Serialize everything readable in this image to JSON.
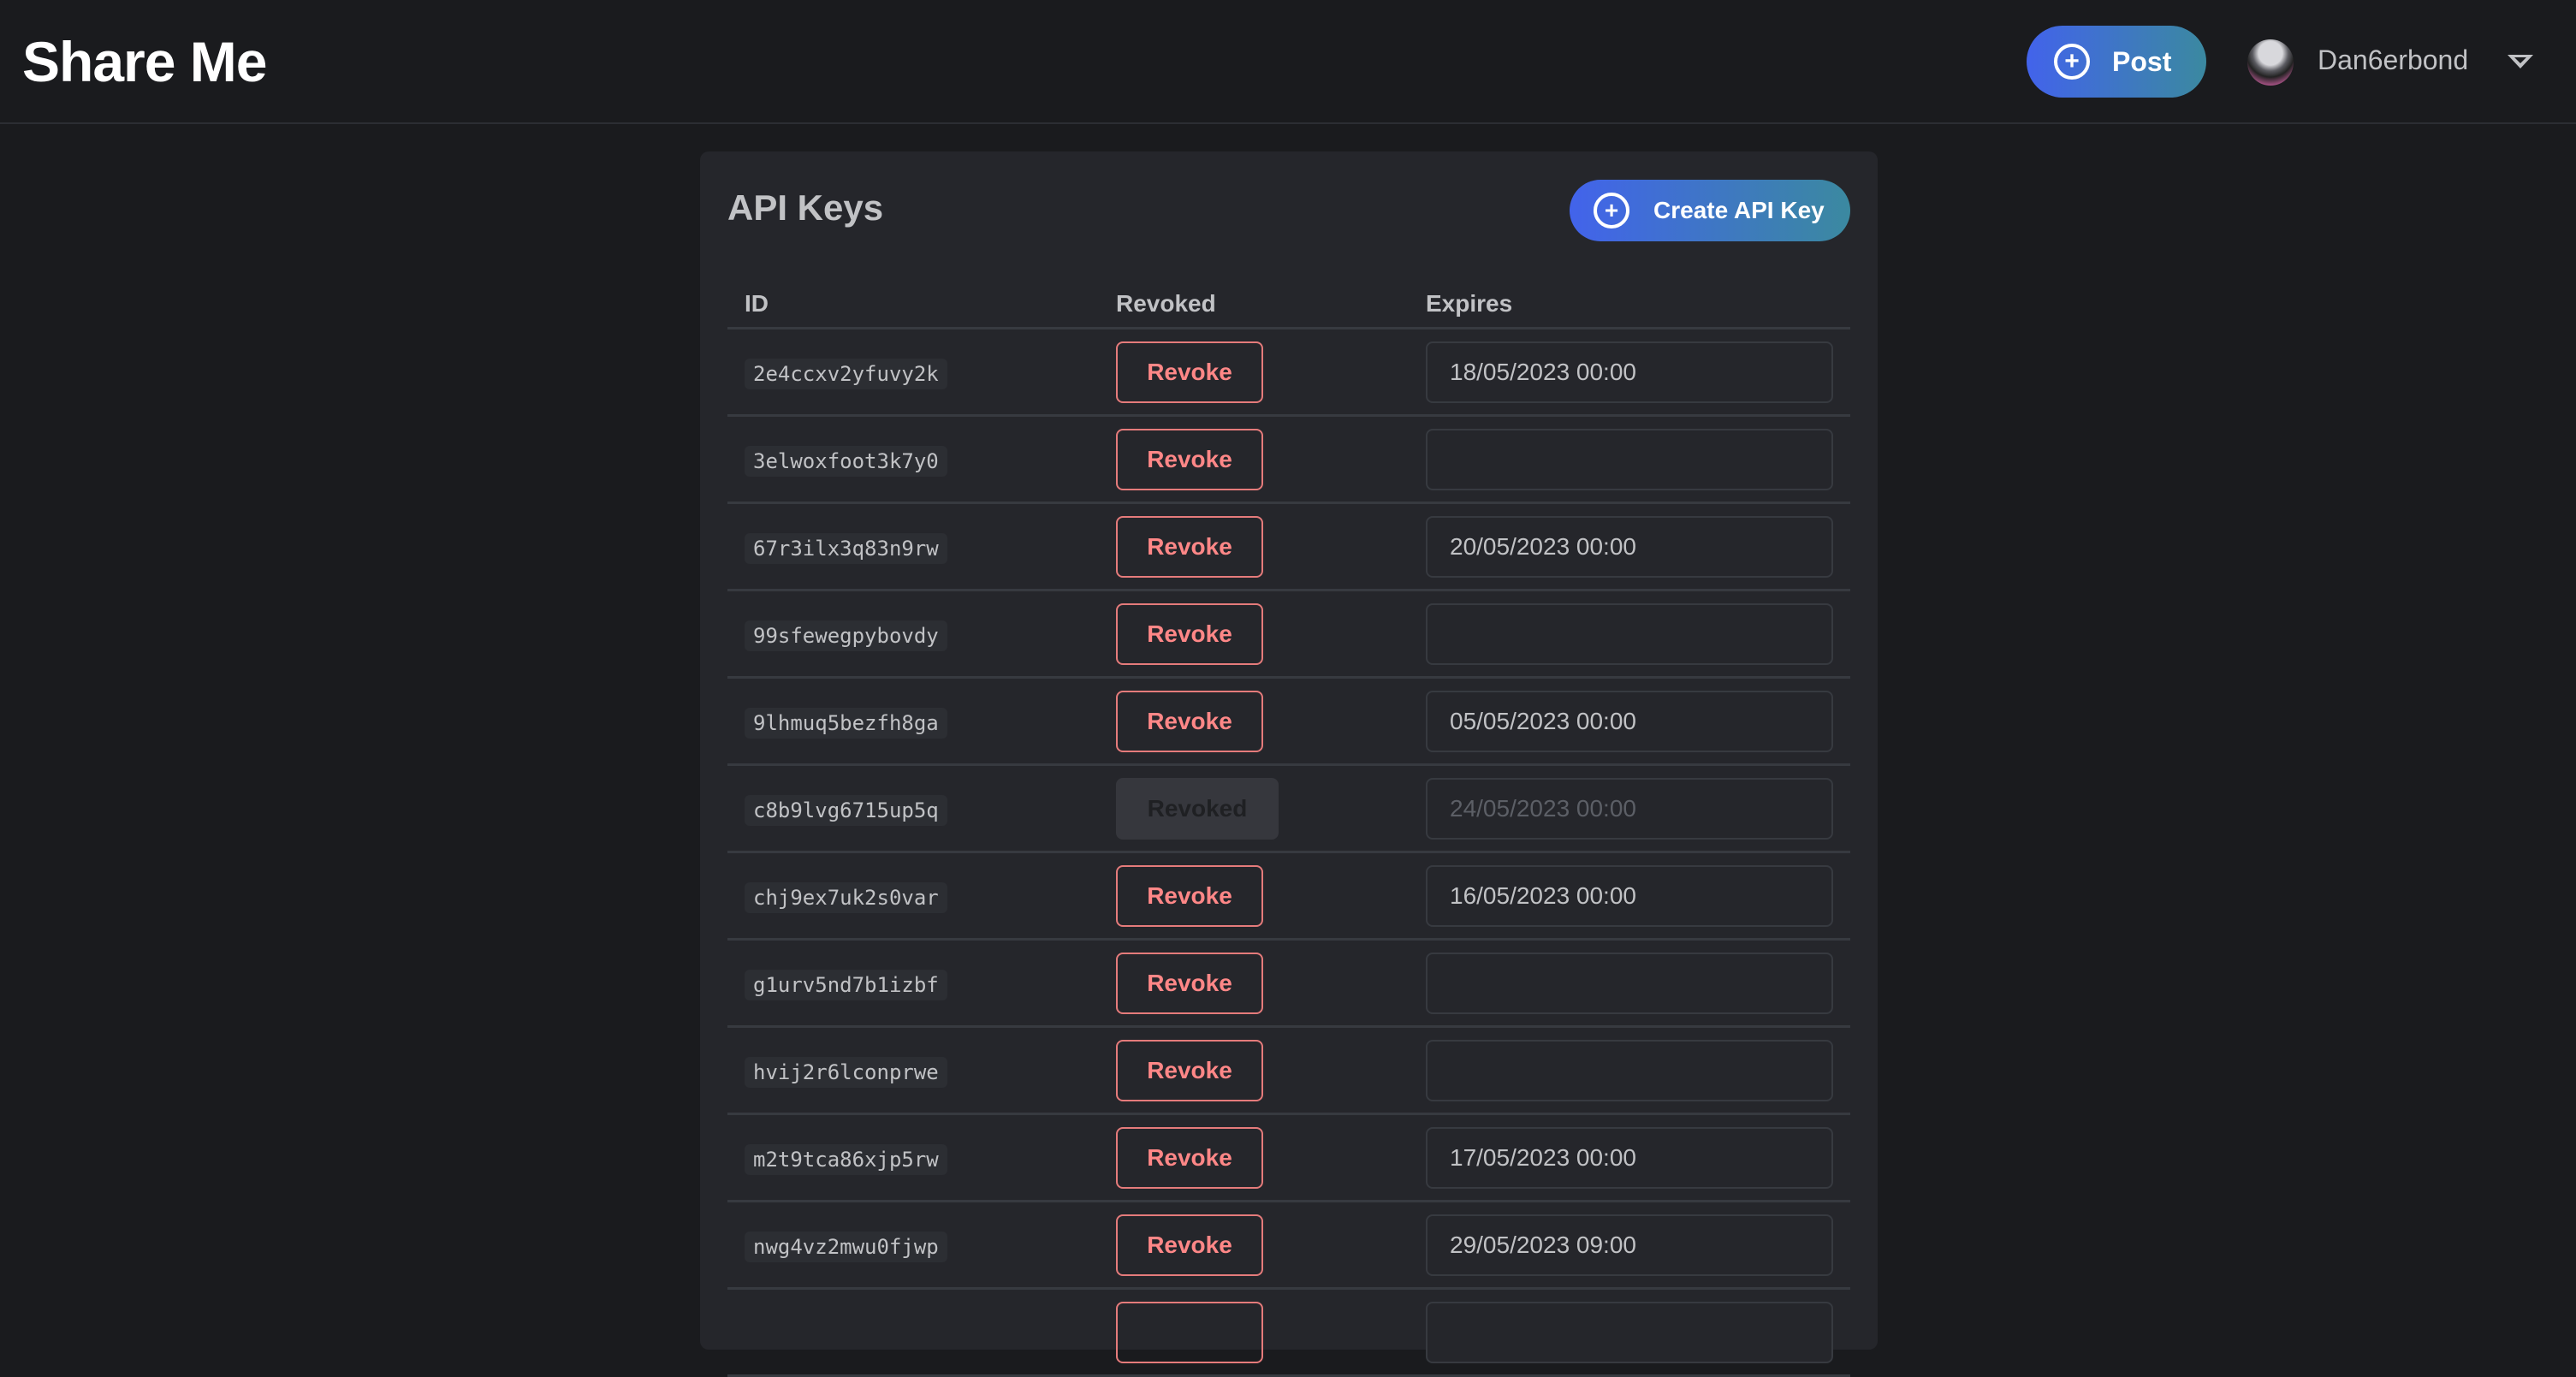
{
  "header": {
    "app_title": "Share Me",
    "post_label": "Post",
    "username": "Dan6erbond"
  },
  "card": {
    "title": "API Keys",
    "create_label": "Create API Key"
  },
  "table": {
    "columns": [
      "ID",
      "Revoked",
      "Expires"
    ],
    "rows": [
      {
        "id": "2e4ccxv2yfuvy2k",
        "action": "Revoke",
        "revoked": false,
        "expires": "18/05/2023 00:00"
      },
      {
        "id": "3elwoxfoot3k7y0",
        "action": "Revoke",
        "revoked": false,
        "expires": ""
      },
      {
        "id": "67r3ilx3q83n9rw",
        "action": "Revoke",
        "revoked": false,
        "expires": "20/05/2023 00:00"
      },
      {
        "id": "99sfewegpybovdy",
        "action": "Revoke",
        "revoked": false,
        "expires": ""
      },
      {
        "id": "9lhmuq5bezfh8ga",
        "action": "Revoke",
        "revoked": false,
        "expires": "05/05/2023 00:00"
      },
      {
        "id": "c8b9lvg6715up5q",
        "action": "Revoked",
        "revoked": true,
        "expires": "24/05/2023 00:00"
      },
      {
        "id": "chj9ex7uk2s0var",
        "action": "Revoke",
        "revoked": false,
        "expires": "16/05/2023 00:00"
      },
      {
        "id": "g1urv5nd7b1izbf",
        "action": "Revoke",
        "revoked": false,
        "expires": ""
      },
      {
        "id": "hvij2r6lconprwe",
        "action": "Revoke",
        "revoked": false,
        "expires": ""
      },
      {
        "id": "m2t9tca86xjp5rw",
        "action": "Revoke",
        "revoked": false,
        "expires": "17/05/2023 00:00"
      },
      {
        "id": "nwg4vz2mwu0fjwp",
        "action": "Revoke",
        "revoked": false,
        "expires": "29/05/2023 09:00"
      },
      {
        "id": "",
        "action": "",
        "revoked": false,
        "expires": ""
      }
    ]
  },
  "colors": {
    "background": "#1a1b1e",
    "card": "#25262b",
    "accent_gradient_start": "#4263eb",
    "accent_gradient_end": "#3b89a0",
    "danger": "#ff8787"
  }
}
